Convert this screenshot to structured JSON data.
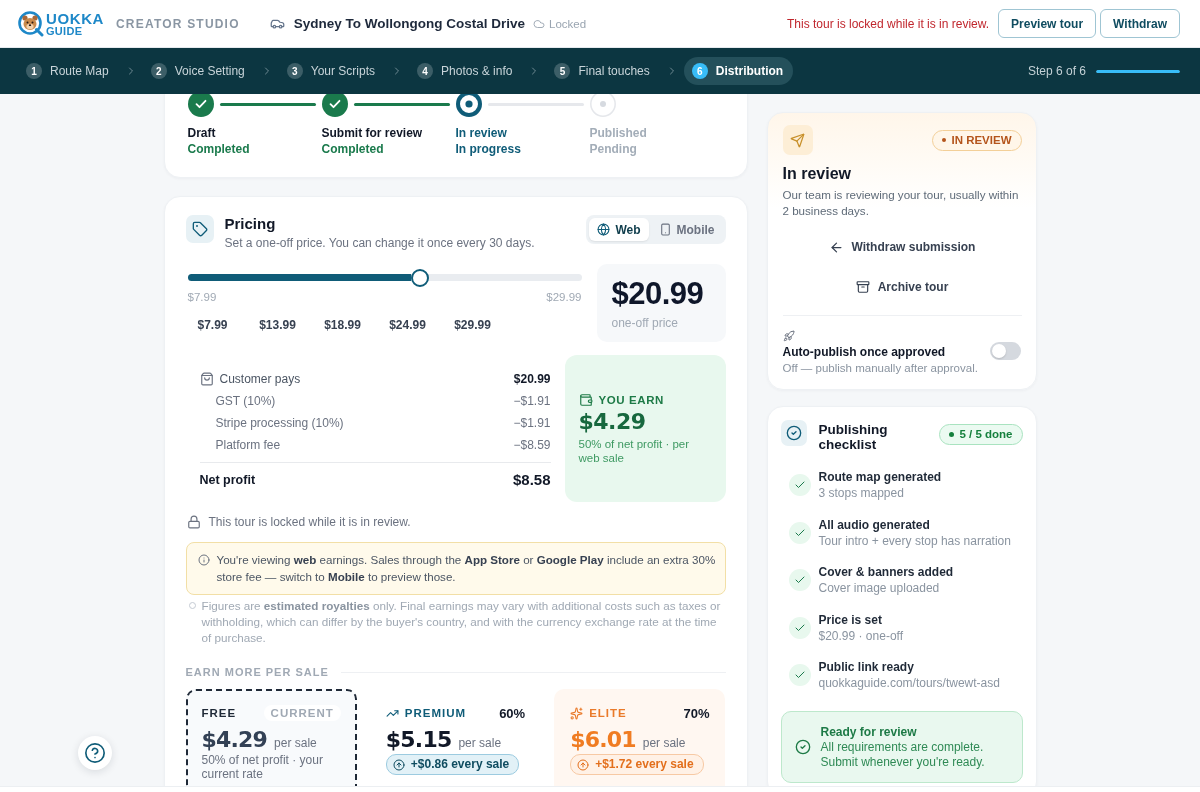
{
  "header": {
    "logo": {
      "line_1": "UOKKA",
      "line_2": "GUIDE"
    },
    "section": "CREATOR STUDIO",
    "tour_title": "Sydney To Wollongong Costal Drive",
    "lock_status": "Locked",
    "notice": "This tour is locked while it is in review.",
    "buttons": [
      "Preview tour",
      "Withdraw"
    ]
  },
  "steps_nav": {
    "steps": [
      {
        "number": "1",
        "label": "Route Map",
        "selected": false
      },
      {
        "number": "2",
        "label": "Voice Setting",
        "selected": false
      },
      {
        "number": "3",
        "label": "Your Scripts",
        "selected": false
      },
      {
        "number": "4",
        "label": "Photos & info",
        "selected": false
      },
      {
        "number": "5",
        "label": "Final touches",
        "selected": false
      },
      {
        "number": "6",
        "label": "Distribution",
        "selected": true
      }
    ],
    "progress_label": "Step 6 of 6",
    "level": 1
  },
  "review_stepper": [
    {
      "label": "Draft",
      "status": "Completed",
      "kind": "done"
    },
    {
      "label": "Submit for review",
      "status": "Completed",
      "kind": "done"
    },
    {
      "label": "In review",
      "status": "In progress",
      "kind": "active"
    },
    {
      "label": "Published",
      "status": "Pending",
      "kind": "todo"
    }
  ],
  "pricing": {
    "title": "Pricing",
    "subtitle": "Set a one-off price. You can change it once every 30 days.",
    "platforms": [
      {
        "kind": "web",
        "label": "Web",
        "selected": true
      },
      {
        "kind": "mobile",
        "label": "Mobile",
        "selected": false
      }
    ],
    "slider": {
      "level": 0.59,
      "min_label": "$7.99",
      "max_label": "$29.99"
    },
    "presets": [
      "$7.99",
      "$13.99",
      "$18.99",
      "$24.99",
      "$29.99"
    ],
    "price": {
      "value": "$20.99",
      "caption": "one-off price"
    },
    "breakdown": [
      {
        "kind": "gross",
        "label": "Customer pays",
        "value": "$20.99"
      },
      {
        "kind": "fee",
        "label": "GST (10%)",
        "value": "−$1.91"
      },
      {
        "kind": "fee",
        "label": "Stripe processing (10%)",
        "value": "−$1.91"
      },
      {
        "kind": "fee",
        "label": "Platform fee",
        "value": "−$8.59"
      },
      {
        "kind": "net",
        "label": "Net profit",
        "value": "$8.58"
      }
    ],
    "earnings": {
      "label": "YOU EARN",
      "value": "$4.29",
      "note": "50% of net profit · per web sale"
    },
    "lock_note": "This tour is locked while it is in review.",
    "info": "You're viewing **web** earnings. Sales through the **App Store** or **Google Play** include an extra 30% store fee — switch to **Mobile** to preview those.",
    "footnote": "Figures are **estimated royalties** only. Final earnings may vary with additional costs such as taxes or withholding, which can differ by the buyer's country, and with the currency exchange rate at the time of purchase.",
    "tiers_heading": "EARN MORE PER SALE",
    "tiers": [
      {
        "kind": "free",
        "name": "FREE",
        "badge": "CURRENT",
        "current": true,
        "amount": "$4.29",
        "unit": "per sale",
        "note": "50% of net profit · your current rate"
      },
      {
        "kind": "premium",
        "name": "PREMIUM",
        "share": "60%",
        "current": false,
        "amount": "$5.15",
        "unit": "per sale",
        "gain": "+$0.86 every sale"
      },
      {
        "kind": "elite",
        "name": "ELITE",
        "share": "70%",
        "current": false,
        "amount": "$6.01",
        "unit": "per sale",
        "gain": "+$1.72 every sale"
      }
    ]
  },
  "review_card": {
    "badge": "IN REVIEW",
    "title": "In review",
    "description": "Our team is reviewing your tour, usually within 2 business days.",
    "actions": [
      {
        "kind": "withdraw",
        "label": "Withdraw submission"
      },
      {
        "kind": "archive",
        "label": "Archive tour"
      }
    ],
    "auto_publish": {
      "label": "Auto-publish once approved",
      "description": "Off — publish manually after approval.",
      "on": false
    }
  },
  "checklist": {
    "title": "Publishing checklist",
    "badge": "5 / 5 done",
    "items": [
      {
        "title": "Route map generated",
        "detail": "3 stops mapped",
        "done": true
      },
      {
        "title": "All audio generated",
        "detail": "Tour intro + every stop has narration",
        "done": true
      },
      {
        "title": "Cover & banners added",
        "detail": "Cover image uploaded",
        "done": true
      },
      {
        "title": "Price is set",
        "detail": "$20.99 · one-off",
        "done": true
      },
      {
        "title": "Public link ready",
        "detail": "quokkaguide.com/tours/twewt-asd",
        "done": true
      }
    ],
    "ready": {
      "title": "Ready for review",
      "text": "All requirements are complete. Submit whenever you're ready."
    }
  }
}
